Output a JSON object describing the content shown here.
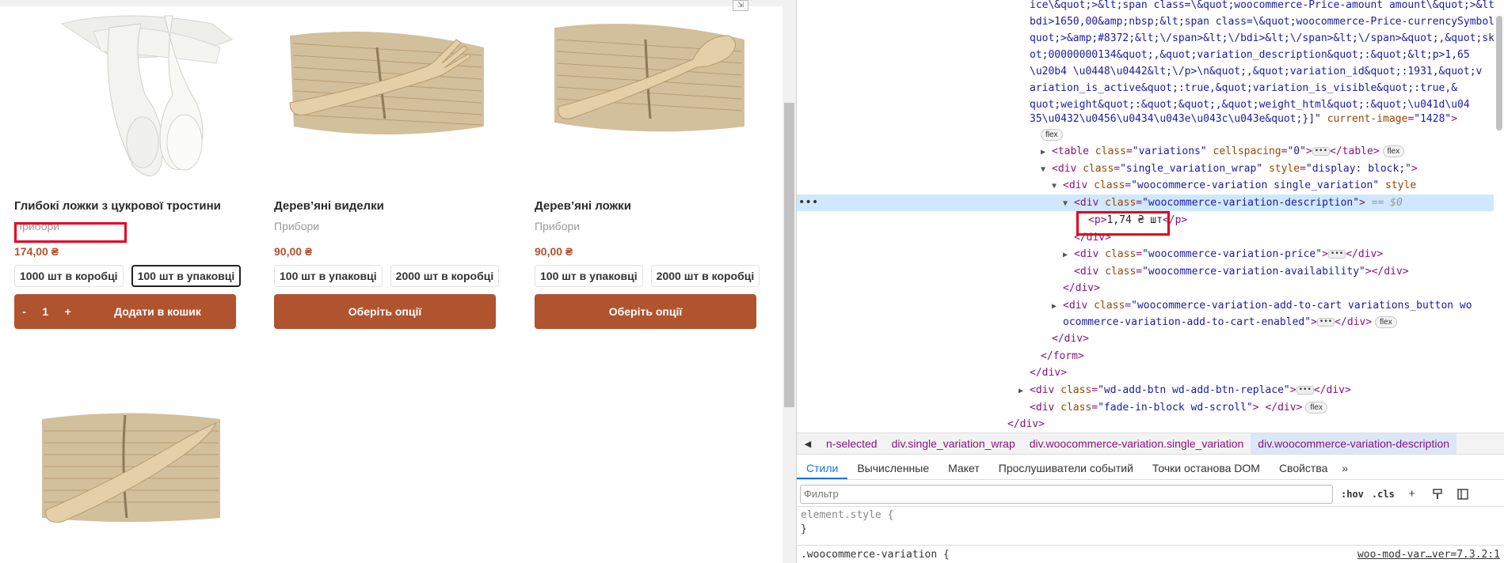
{
  "shop": {
    "products": [
      {
        "title": "Глибокі ложки з цукрової тростини",
        "category": "Прибори",
        "price": "174,00 ₴",
        "options": [
          "1000 шт в коробці",
          "100 шт в упаковці"
        ],
        "selected_option": 1,
        "qty_minus": "-",
        "qty_value": "1",
        "qty_plus": "+",
        "button": "Додати в кошик"
      },
      {
        "title": "Дерев’яні виделки",
        "category": "Прибори",
        "price": "90,00 ₴",
        "options": [
          "100 шт в упаковці",
          "2000 шт в коробці"
        ],
        "button": "Оберіть опції"
      },
      {
        "title": "Дерев’яні ложки",
        "category": "Прибори",
        "price": "90,00 ₴",
        "options": [
          "100 шт в упаковці",
          "2000 шт в коробці"
        ],
        "button": "Оберіть опції"
      }
    ],
    "accent_color": "#b0532f"
  },
  "devtools": {
    "dom_lines": [
      "ice\\&quot;>&lt;span class=\\&quot;woocommerce-Price-amount amount\\&quot;>&lt;",
      "bdi>1650,00&amp;nbsp;&lt;span class=\\&quot;woocommerce-Price-currencySymbol\\&",
      "quot;>&amp;#8372;&lt;\\/span>&lt;\\/bdi>&lt;\\/span>&lt;\\/span>&quot;,&quot;sku&quot;:&qu",
      "ot;00000000134&quot;,&quot;variation_description&quot;:&quot;&lt;p>1,65",
      "\\u20b4 \\u0448\\u0442&lt;\\/p>\\n&quot;,&quot;variation_id&quot;:1931,&quot;v",
      "ariation_is_active&quot;:true,&quot;variation_is_visible&quot;:true,&",
      "quot;weight&quot;:&quot;&quot;,&quot;weight_html&quot;:&quot;\\u041d\\u04",
      "35\\u0432\\u0456\\u0434\\u043e\\u043c\\u043e&quot;}]\""
    ],
    "dom_line_end_attr": "current-image",
    "dom_line_end_value": "\"1428\"",
    "flex_badge": "flex",
    "selected_marker": "== $0",
    "p_text": "1,74 ₴ шт",
    "tag_table": "table",
    "tag_div": "div",
    "tag_p": "p",
    "tag_form": "form",
    "attr_class": "class",
    "attr_cellspacing": "cellspacing",
    "attr_style": "style",
    "val_variations": "\"variations\"",
    "val_zero": "\"0\"",
    "val_single_variation_wrap": "\"single_variation_wrap\"",
    "val_display_block": "\"display: block;\"",
    "val_wc_variation_single": "\"woocommerce-variation single_variation\"",
    "val_wc_variation_description": "\"woocommerce-variation-description\"",
    "val_wc_variation_price": "\"woocommerce-variation-price\"",
    "val_wc_variation_availability": "\"woocommerce-variation-availability\"",
    "val_add_to_cart_1": "\"woocommerce-variation-add-to-cart variations_button wo",
    "val_add_to_cart_2": "ocommerce-variation-add-to-cart-enabled\"",
    "val_wd_add_btn": "\"wd-add-btn wd-add-btn-replace\"",
    "val_fade_in": "\"fade-in-block wd-scroll\"",
    "breadcrumbs": [
      "n-selected",
      "div.single_variation_wrap",
      "div.woocommerce-variation.single_variation",
      "div.woocommerce-variation-description"
    ],
    "tabs": [
      "Стили",
      "Вычисленные",
      "Макет",
      "Прослушиватели событий",
      "Точки останова DOM",
      "Свойства"
    ],
    "active_tab": "Стили",
    "more_tabs": "»",
    "filter_placeholder": "Фильтр",
    "filter_hov": ":hov",
    "filter_cls": ".cls",
    "styles_element_style": "element.style {",
    "styles_close": "}",
    "styles_rule": ".woocommerce-variation {",
    "styles_source": "woo-mod-var…ver=7.3.2:1"
  }
}
